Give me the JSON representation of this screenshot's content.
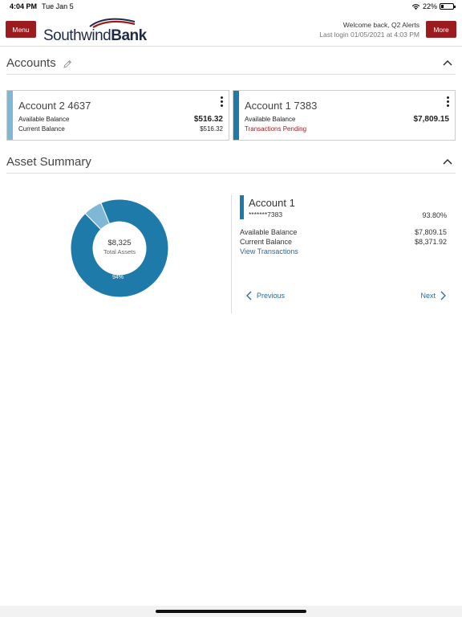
{
  "status_bar": {
    "time": "4:04 PM",
    "date": "Tue Jan 5",
    "battery": "22%"
  },
  "header": {
    "menu_label": "Menu",
    "more_label": "More",
    "brand_light": "Southwind",
    "brand_bold": "Bank",
    "welcome": "Welcome back, Q2 Alerts",
    "last_login": "Last login 01/05/2021 at 4:03 PM",
    "brand_color": "#9b1b1f"
  },
  "accounts_section": {
    "title": "Accounts",
    "cards": [
      {
        "name": "Account 2 4637",
        "accent_color": "#7fb8d6",
        "row1_label": "Available Balance",
        "row1_value": "$516.32",
        "row2_label": "Current Balance",
        "row2_value": "$516.32"
      },
      {
        "name": "Account 1 7383",
        "accent_color": "#1e7aa8",
        "row1_label": "Available Balance",
        "row1_value": "$7,809.15",
        "row2_label": "Transactions Pending"
      }
    ]
  },
  "asset_summary": {
    "title": "Asset Summary",
    "total_value": "$8,325",
    "total_label": "Total Assets",
    "slice_label": "94%",
    "slices": [
      {
        "name": "Account 1",
        "fraction": 0.938,
        "color": "#1e7aa8"
      },
      {
        "name": "Account 2",
        "fraction": 0.062,
        "color": "#7fb8d6"
      }
    ],
    "detail": {
      "name": "Account 1",
      "masked_number": "*******7383",
      "percent": "93.80%",
      "available_label": "Available Balance",
      "available_value": "$7,809.15",
      "current_label": "Current Balance",
      "current_value": "$8,371.92",
      "view_link": "View Transactions"
    },
    "nav": {
      "previous": "Previous",
      "next": "Next"
    }
  }
}
